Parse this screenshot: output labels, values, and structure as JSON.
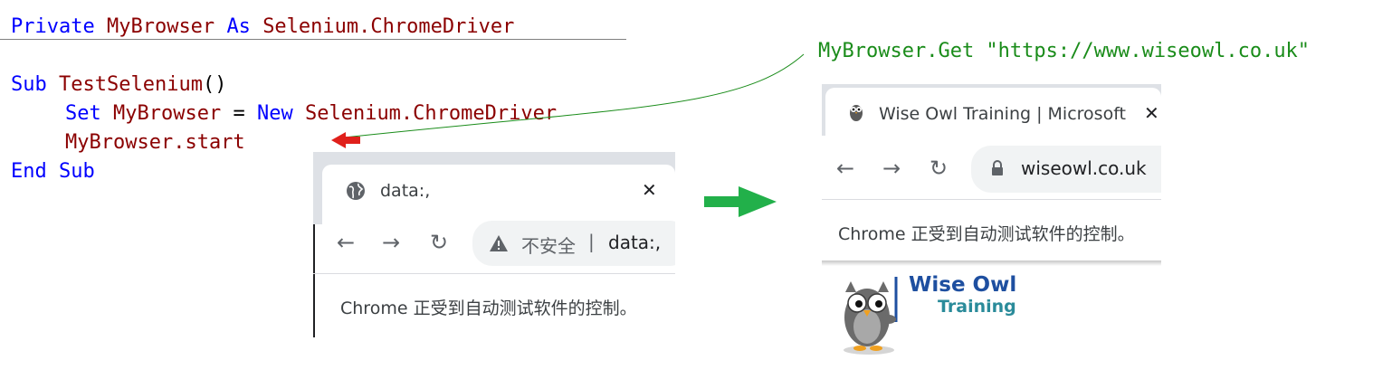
{
  "code": {
    "line1": {
      "private": "Private",
      "var": "MyBrowser",
      "as": "As",
      "type": "Selenium.ChromeDriver"
    },
    "line3": {
      "sub": "Sub",
      "name": "TestSelenium",
      "parens": "()"
    },
    "line4": {
      "set": "Set",
      "var": "MyBrowser",
      "eq": " = ",
      "new": "New",
      "type": "Selenium.ChromeDriver"
    },
    "line5": {
      "call": "MyBrowser.start"
    },
    "line6": {
      "end": "End",
      "sub": "Sub"
    }
  },
  "annotation": {
    "get_call": "MyBrowser.Get \"https://www.wiseowl.co.uk\""
  },
  "browser_before": {
    "tab_title": "data:,",
    "close_glyph": "✕",
    "omnibox": {
      "warning": "不安全",
      "separator": "|",
      "url": "data:,"
    },
    "infobar": "Chrome 正受到自动测试软件的控制。"
  },
  "browser_after": {
    "tab_title": "Wise Owl Training | Microsoft",
    "close_glyph": "✕",
    "omnibox": {
      "url": "wiseowl.co.uk"
    },
    "infobar": "Chrome 正受到自动测试软件的控制。",
    "logo": {
      "line1": "Wise Owl",
      "line2": "Training"
    }
  },
  "icons": {
    "back": "←",
    "forward": "→",
    "reload": "↻",
    "globe": "globe-icon",
    "lock": "lock-icon",
    "warning": "warning-icon",
    "owl": "owl-icon"
  },
  "colors": {
    "keyword": "#0000ff",
    "identifier": "#8b0000",
    "annotation": "#1a8c1a",
    "arrow_red": "#e0201b",
    "arrow_green": "#22b04a",
    "logo_blue": "#1e4fa0",
    "logo_teal": "#2a8b9a"
  }
}
